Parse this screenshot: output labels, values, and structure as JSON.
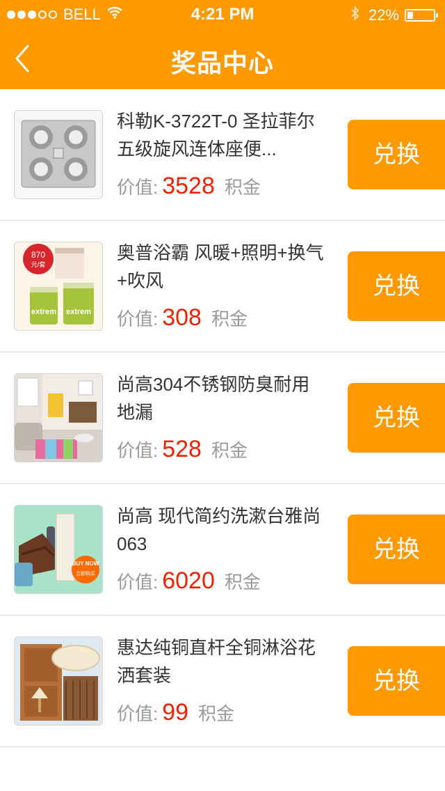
{
  "status_bar": {
    "signal_dots_full": 3,
    "signal_dots_empty": 2,
    "carrier": "BELL",
    "time": "4:21 PM",
    "battery": "22%",
    "battery_level": 0.22
  },
  "nav": {
    "title": "奖品中心",
    "back_icon": "chevron-left-icon"
  },
  "colors": {
    "brand": "#ff9900",
    "price": "#ee2200",
    "muted": "#999999",
    "text": "#333333"
  },
  "items": [
    {
      "name": "科勒K-3722T-0 圣拉菲尔五级旋风连体座便...",
      "price_label": "价值:",
      "price": "3528",
      "unit": "积金",
      "button": "兑换",
      "image": "bathroom-heater-image"
    },
    {
      "name": "奥普浴霸 风暖+照明+换气+吹风",
      "price_label": "价值:",
      "price": "308",
      "unit": "积金",
      "button": "兑换",
      "image": "paint-buckets-image"
    },
    {
      "name": "尚高304不锈钢防臭耐用地漏",
      "price_label": "价值:",
      "price": "528",
      "unit": "积金",
      "button": "兑换",
      "image": "living-room-image"
    },
    {
      "name": "尚高 现代简约洗漱台雅尚063",
      "price_label": "价值:",
      "price": "6020",
      "unit": "积金",
      "button": "兑换",
      "image": "furniture-image"
    },
    {
      "name": "惠达纯铜直杆全铜淋浴花洒套装",
      "price_label": "价值:",
      "price": "99",
      "unit": "积金",
      "button": "兑换",
      "image": "wood-panel-image"
    }
  ],
  "thumb_text": {
    "paint_price": "870",
    "paint_price_unit": "元/套",
    "paint_brand": "extrem",
    "buy_now": "BUY NOW",
    "buy_now_sub": "立即购买"
  }
}
